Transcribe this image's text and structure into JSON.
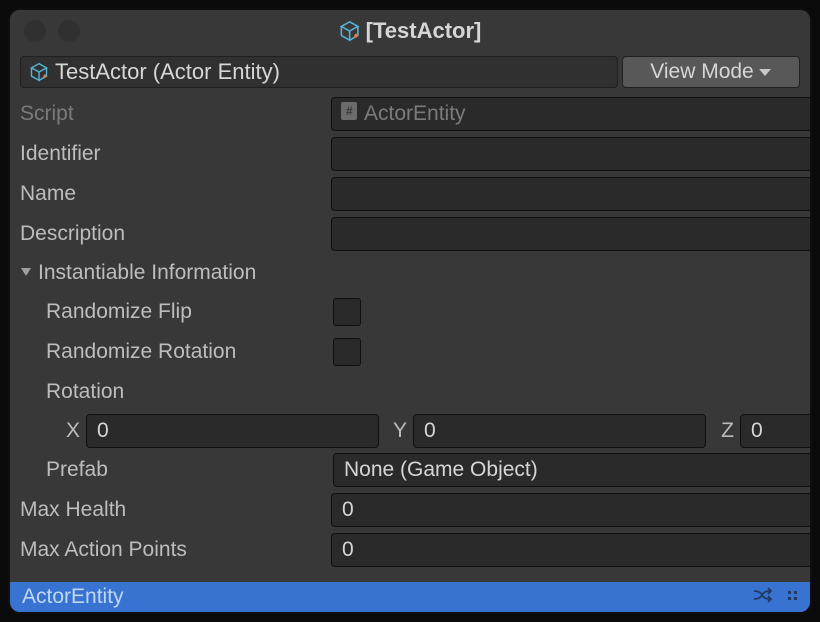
{
  "window_title": "[TestActor]",
  "object_label": "TestActor (Actor Entity)",
  "view_mode_label": "View Mode",
  "fields": {
    "script_label": "Script",
    "script_value": "ActorEntity",
    "identifier_label": "Identifier",
    "identifier_value": "",
    "name_label": "Name",
    "name_value": "",
    "description_label": "Description",
    "description_value": ""
  },
  "instantiable": {
    "header": "Instantiable Information",
    "randomize_flip_label": "Randomize Flip",
    "randomize_rotation_label": "Randomize Rotation",
    "rotation_label": "Rotation",
    "rotation": {
      "x_label": "X",
      "x": "0",
      "y_label": "Y",
      "y": "0",
      "z_label": "Z",
      "z": "0"
    },
    "prefab_label": "Prefab",
    "prefab_value": "None (Game Object)"
  },
  "max_health_label": "Max Health",
  "max_health_value": "0",
  "max_ap_label": "Max Action Points",
  "max_ap_value": "0",
  "footer_text": "ActorEntity"
}
